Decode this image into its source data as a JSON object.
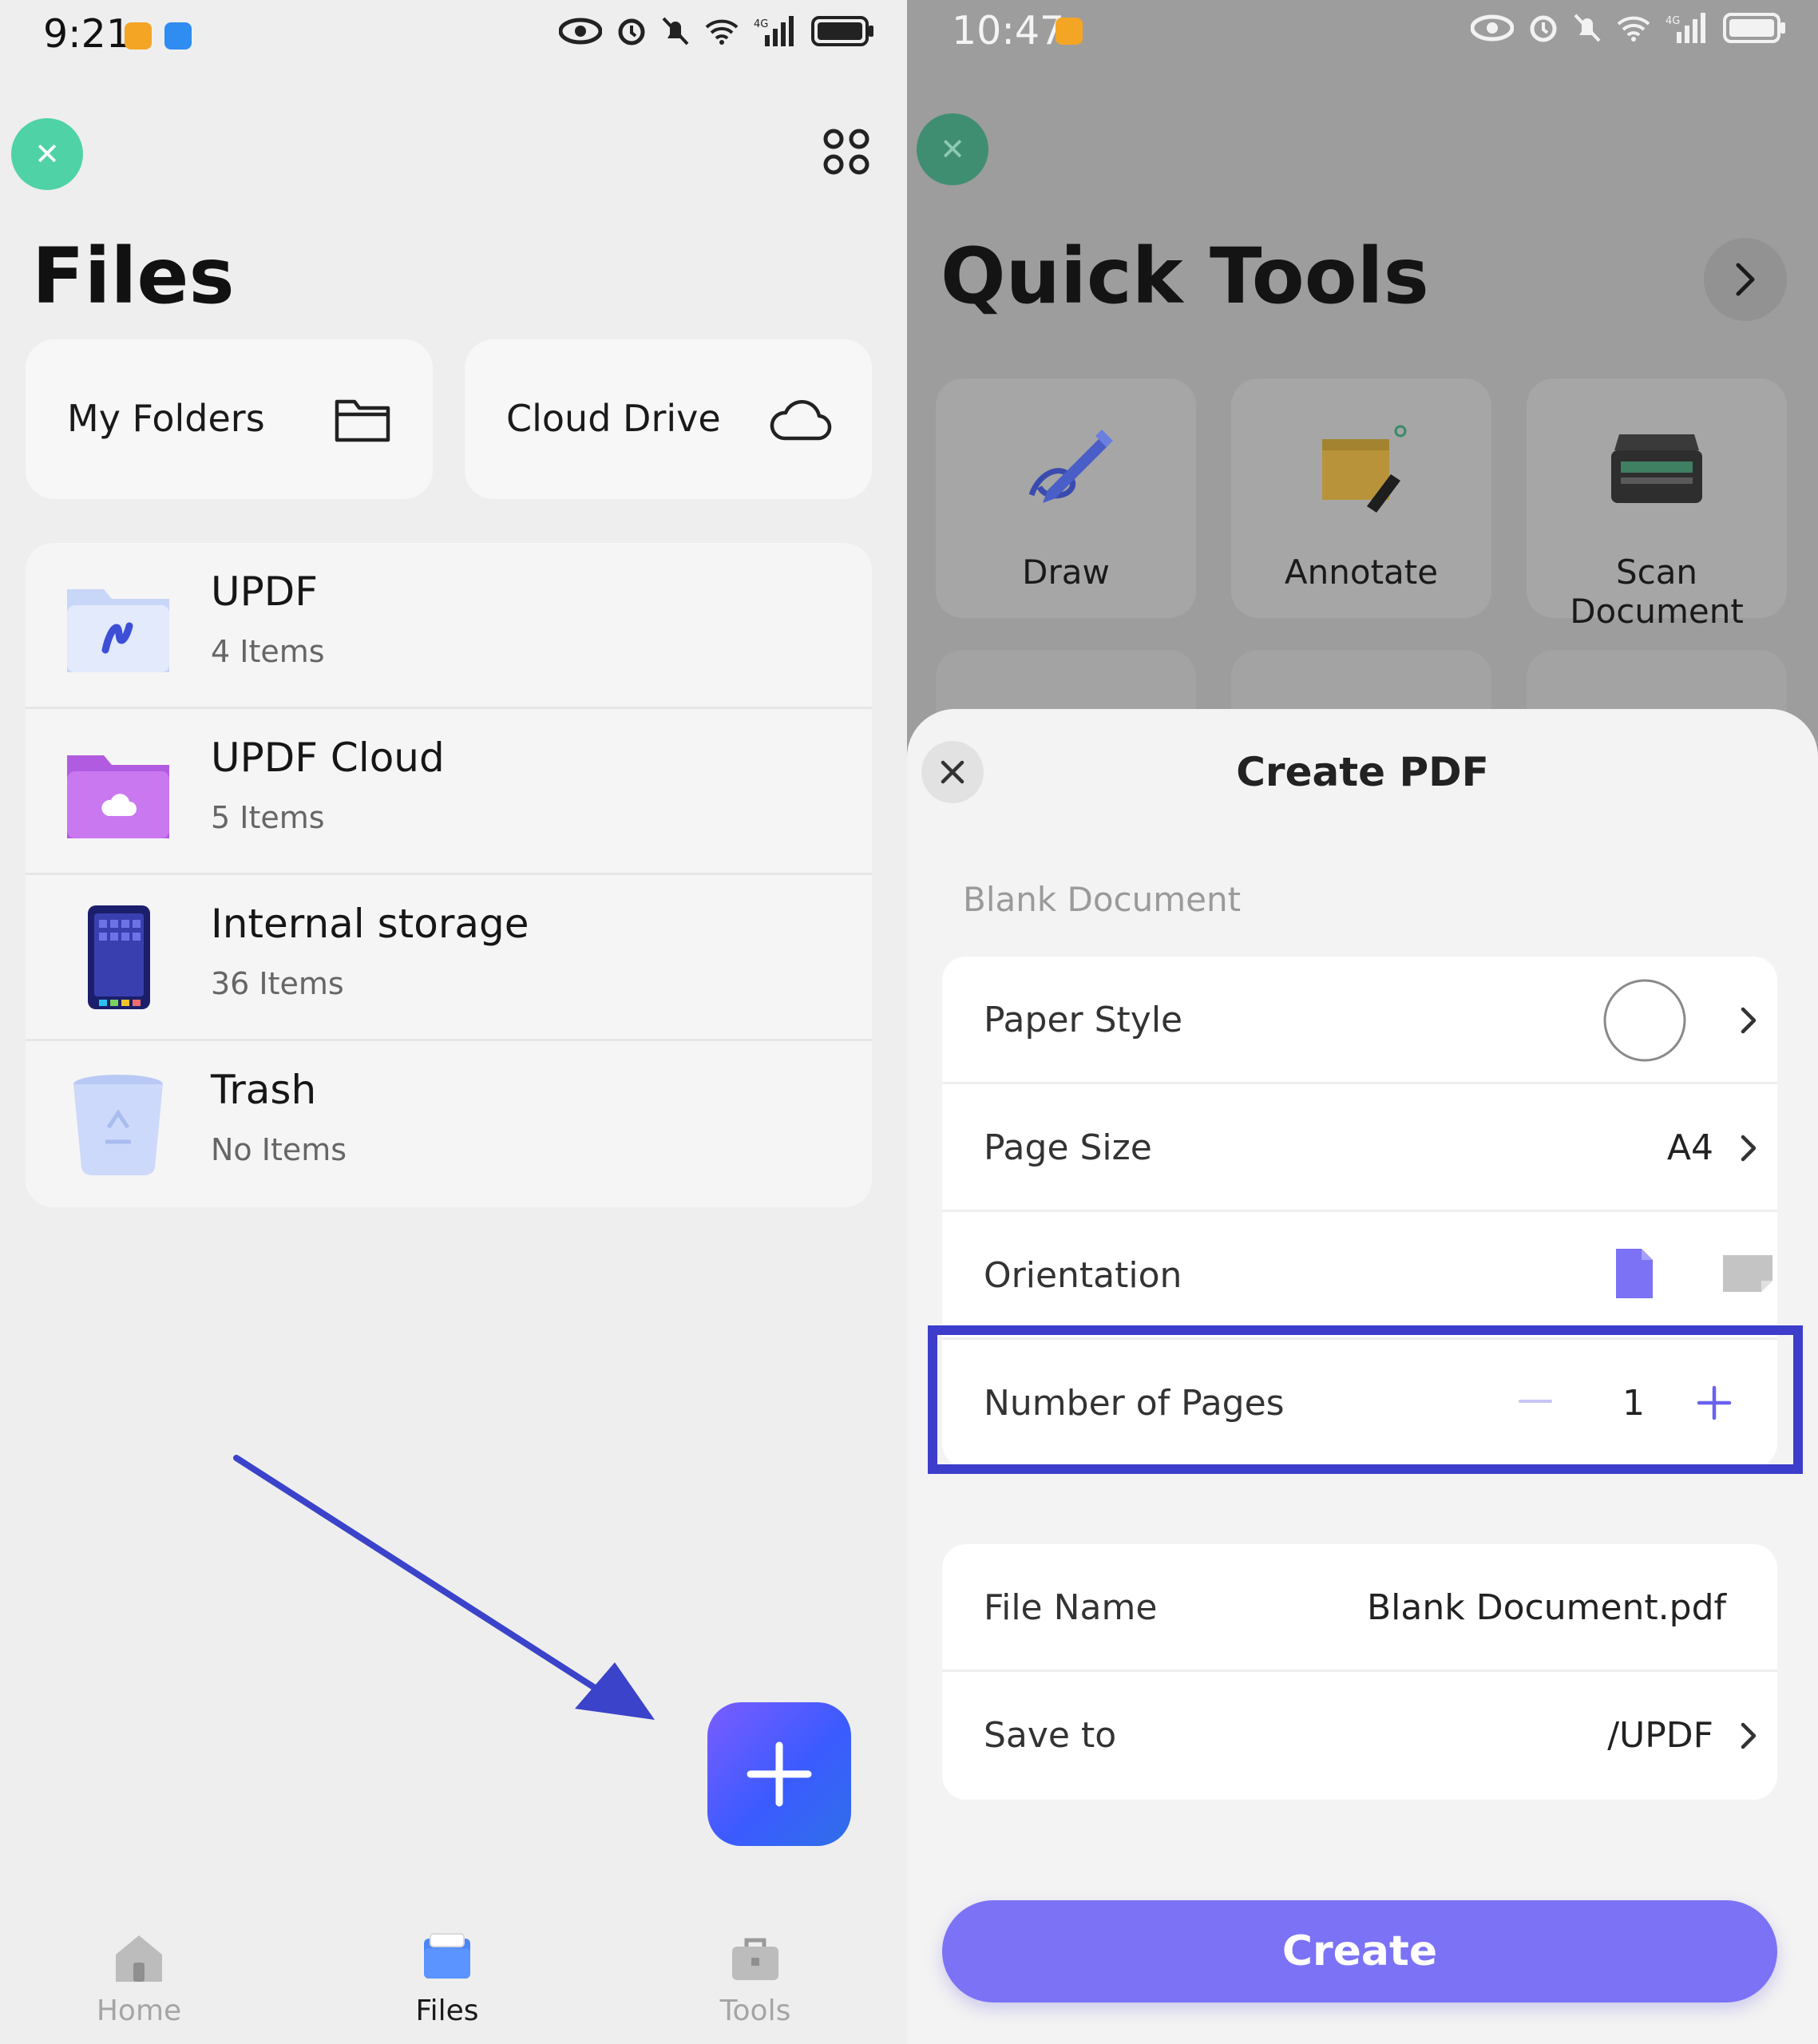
{
  "left": {
    "status": {
      "time": "9:21"
    },
    "title": "Files",
    "tiles": [
      {
        "label": "My Folders",
        "icon": "folder-outline-icon"
      },
      {
        "label": "Cloud Drive",
        "icon": "cloud-outline-icon"
      }
    ],
    "storage": [
      {
        "name": "UPDF",
        "count": "4 Items",
        "icon": "updf-folder-icon"
      },
      {
        "name": "UPDF Cloud",
        "count": "5 Items",
        "icon": "updf-cloud-folder-icon"
      },
      {
        "name": "Internal storage",
        "count": "36 Items",
        "icon": "phone-storage-icon"
      },
      {
        "name": "Trash",
        "count": "No Items",
        "icon": "trash-bin-icon"
      }
    ],
    "nav": [
      {
        "label": "Home",
        "active": false
      },
      {
        "label": "Files",
        "active": true
      },
      {
        "label": "Tools",
        "active": false
      }
    ],
    "colors": {
      "accent": "#3b5bff",
      "close_fab": "#4fd2a5",
      "annotation_arrow": "#3a43c9"
    }
  },
  "right": {
    "status": {
      "time": "10:47"
    },
    "title": "Quick Tools",
    "tools": [
      {
        "label": "Draw",
        "icon": "draw-pen-icon"
      },
      {
        "label": "Annotate",
        "icon": "sticky-note-icon"
      },
      {
        "label": "Scan Document",
        "icon": "scanner-icon"
      }
    ],
    "sheet": {
      "title": "Create PDF",
      "section": "Blank Document",
      "rows": {
        "paper_style": "Paper Style",
        "page_size": "Page Size",
        "page_size_value": "A4",
        "orientation": "Orientation",
        "orientation_selected": "portrait",
        "pages": "Number of Pages",
        "pages_value": "1",
        "file_name": "File Name",
        "file_name_value": "Blank Document.pdf",
        "save_to": "Save to",
        "save_to_value": "/UPDF"
      },
      "create_label": "Create",
      "colors": {
        "create_button": "#7b72f6",
        "highlight_box": "#3d3dcc",
        "orientation_active": "#7b72f6"
      }
    }
  }
}
